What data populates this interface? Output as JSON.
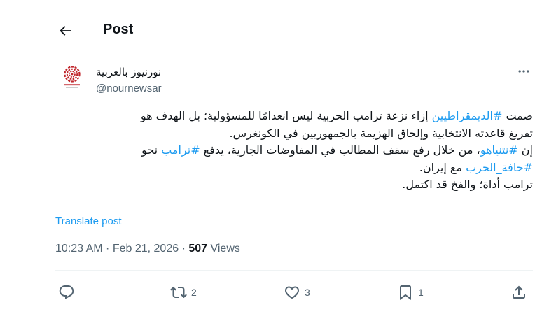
{
  "header": {
    "title": "Post"
  },
  "author": {
    "name": "نورنيوز بالعربية",
    "handle": "@nournewsar",
    "avatar_caption": "نور نيوز",
    "avatar_sub": "NOURNEWS"
  },
  "tweet": {
    "line1_a": "صمت ",
    "line1_tag": "#الديمقراطيين",
    "line1_b": " إزاء نزعة ترامب الحربية ليس انعدامًا للمسؤولية؛ بل الهدف هو",
    "line2": "تفريغ قاعدته الانتخابية وإلحاق الهزيمة بالجمهوريين في الكونغرس.",
    "line3_a": "إن ",
    "line3_tag1": "#نتنياهو",
    "line3_b": "، من خلال رفع سقف المطالب في المفاوضات الجارية، يدفع ",
    "line3_tag2": "#ترامب",
    "line3_c": " نحو",
    "line4_tag": "#حافة_الحرب",
    "line4_b": " مع إيران.",
    "line5": "ترامب أداة؛ والفخ قد اكتمل."
  },
  "translate_label": "Translate post",
  "meta": {
    "time": "10:23 AM · Feb 21, 2026 · ",
    "views_count": "507",
    "views_label": " Views"
  },
  "actions": {
    "replies": "",
    "reposts": "2",
    "likes": "3",
    "bookmarks": "1"
  },
  "colors": {
    "accent": "#1d9bf0",
    "text": "#0f1419",
    "muted": "#536471",
    "border": "#eff3f4",
    "logo": "#c1272d"
  }
}
